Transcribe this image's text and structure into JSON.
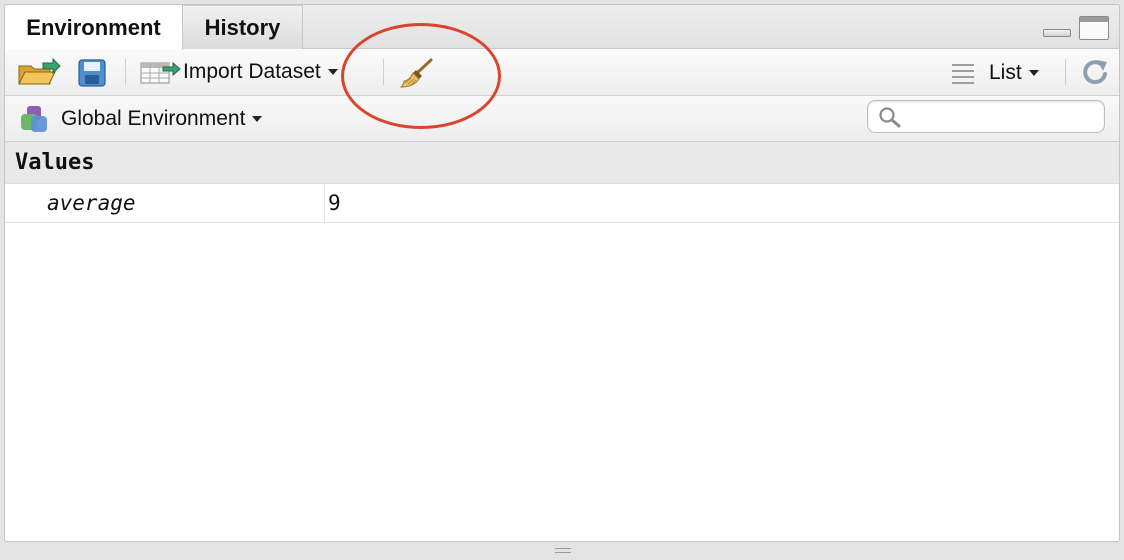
{
  "tabs": [
    {
      "label": "Environment",
      "active": true
    },
    {
      "label": "History",
      "active": false
    }
  ],
  "toolbar": {
    "import_label": "Import Dataset",
    "view_label": "List"
  },
  "env": {
    "selector_label": "Global Environment",
    "search_placeholder": ""
  },
  "values": {
    "section_title": "Values",
    "rows": [
      {
        "name": "average",
        "value": "9"
      }
    ]
  },
  "icons": {
    "open": "open-folder-icon",
    "save": "save-icon",
    "import": "import-dataset-icon",
    "broom": "broom-icon",
    "list": "list-icon",
    "refresh": "refresh-icon",
    "env": "environment-icon",
    "search": "search-icon"
  },
  "colors": {
    "annotation_circle": "#d9452f",
    "accent_green": "#3aa36b"
  }
}
